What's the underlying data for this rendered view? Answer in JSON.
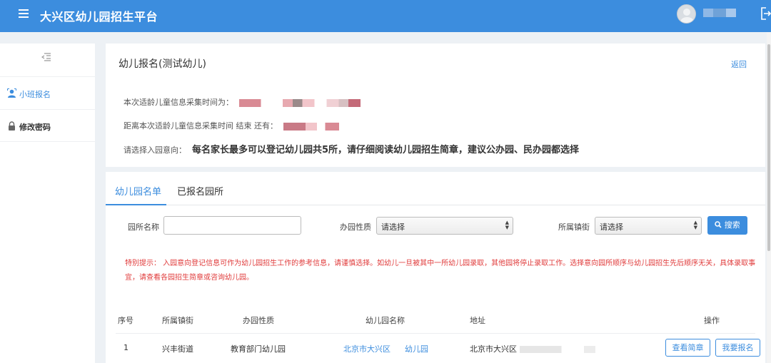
{
  "header": {
    "title": "大兴区幼儿园招生平台",
    "menu_icon": "hamburger-icon",
    "logout_icon": "logout-icon"
  },
  "sidebar": {
    "items": [
      {
        "label": "小班报名",
        "icon": "user-icon",
        "active": true
      },
      {
        "label": "修改密码",
        "icon": "lock-icon",
        "active": false
      }
    ]
  },
  "info_panel": {
    "title": "幼儿报名(测试幼儿)",
    "back_label": "返回",
    "collect_time_label": "本次适龄儿童信息采集时间为：",
    "remaining_label": "距离本次适龄儿童信息采集时间 结束 还有：",
    "intent_label": "请选择入园意向：",
    "intent_note": "每名家长最多可以登记幼儿园共5所，请仔细阅读幼儿园招生简章，建议公办园、民办园都选择"
  },
  "tabs": [
    {
      "label": "幼儿园名单",
      "active": true
    },
    {
      "label": "已报名园所",
      "active": false
    }
  ],
  "filters": {
    "name_label": "园所名称",
    "name_value": "",
    "nature_label": "办园性质",
    "nature_value": "请选择",
    "town_label": "所属镇街",
    "town_value": "请选择",
    "search_label": "搜索"
  },
  "warning": "特别提示：  入园意向登记信息可作为幼儿园招生工作的参考信息，请谨慎选择。如幼儿一旦被其中一所幼儿园录取，其他园将停止录取工作。选择意向园所顺序与幼儿园招生先后顺序无关，具体录取事宜，请查看各园招生简章或咨询幼儿园。",
  "table": {
    "headers": [
      "序号",
      "所属镇街",
      "办园性质",
      "幼儿园名称",
      "地址",
      "操作"
    ],
    "rows": [
      {
        "index": "1",
        "town": "兴丰街道",
        "nature": "教育部门幼儿园",
        "name_part1": "北京市大兴区",
        "name_part2": "幼儿园",
        "address": "北京市大兴区",
        "view_label": "查看简章",
        "apply_label": "我要报名"
      }
    ]
  },
  "colors": {
    "primary": "#3c8dde",
    "warning": "#e03b3b",
    "background": "#edf1f5"
  }
}
